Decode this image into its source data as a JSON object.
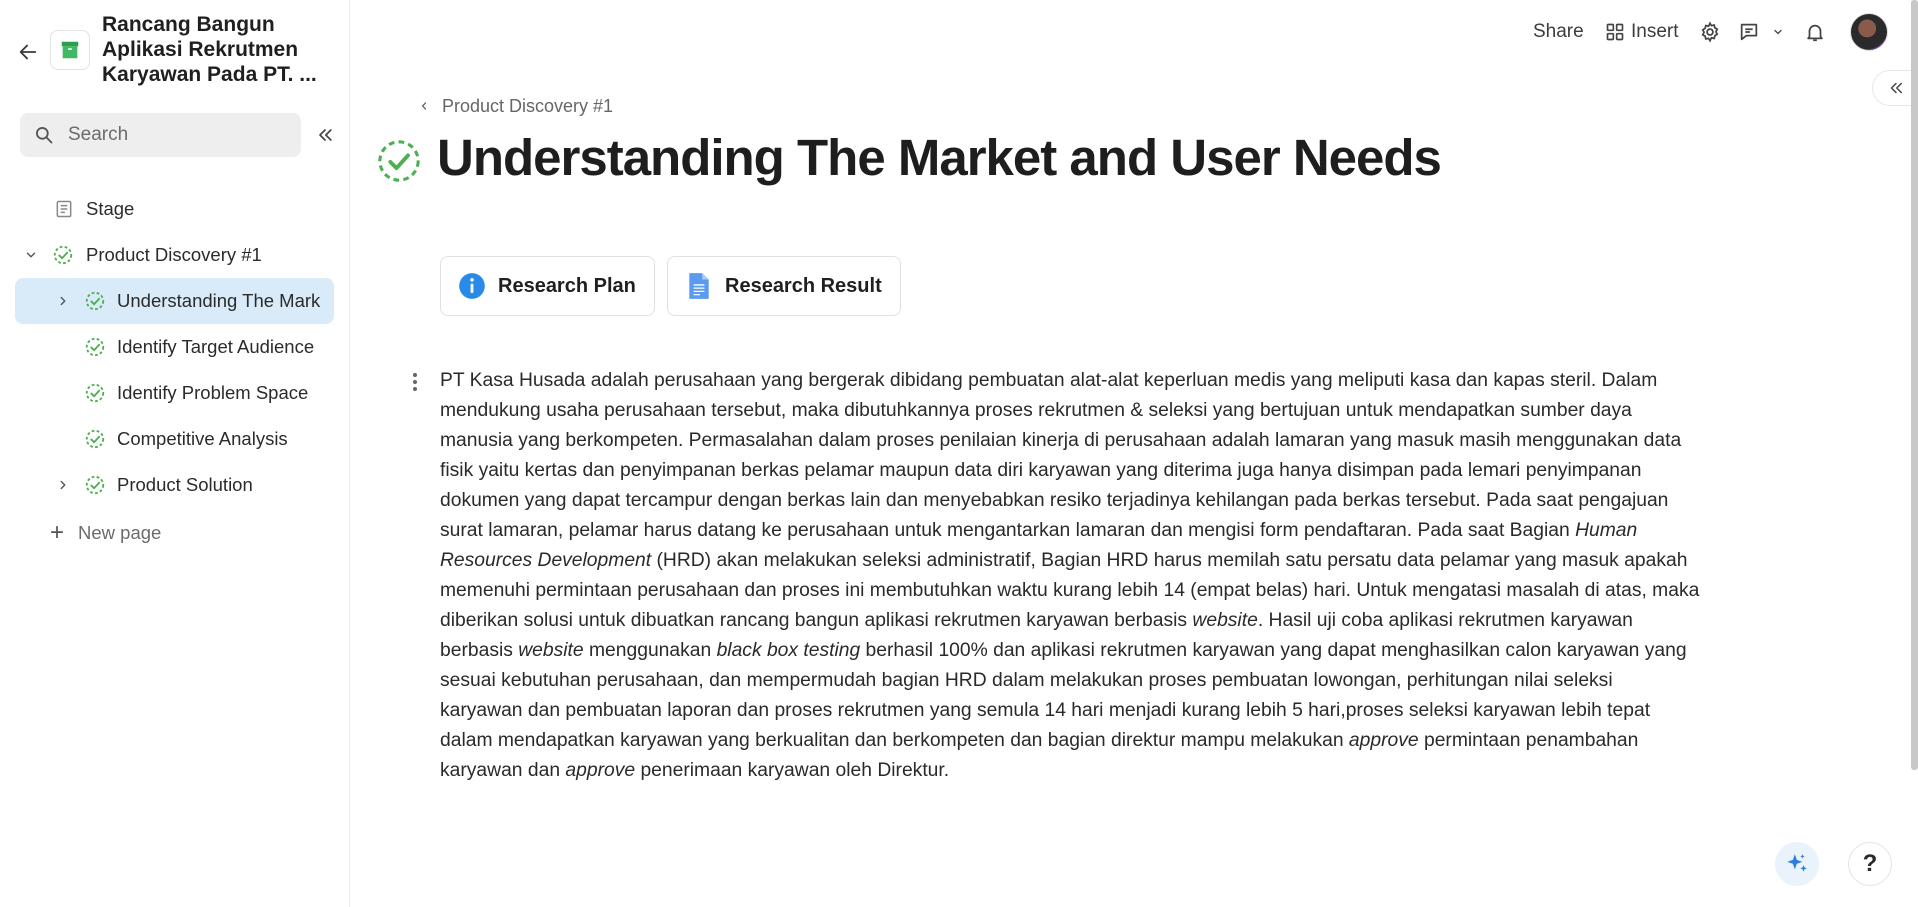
{
  "colors": {
    "accent": "#4caf50",
    "active_bg": "#d9eaf9",
    "info_blue": "#2a8ae8",
    "doc_blue": "#5b9bef"
  },
  "sidebar": {
    "app_title": "Rancang Bangun Aplikasi Rekrutmen Karyawan Pada PT. ...",
    "search_placeholder": "Search",
    "items": [
      {
        "label": "Stage",
        "icon": "document-icon"
      },
      {
        "label": "Product Discovery #1",
        "icon": "progress-check-icon",
        "expanded": true
      },
      {
        "label": "Understanding The Mark",
        "icon": "progress-check-icon",
        "active": true
      },
      {
        "label": "Identify Target Audience",
        "icon": "progress-check-icon"
      },
      {
        "label": "Identify Problem Space",
        "icon": "progress-check-icon"
      },
      {
        "label": "Competitive Analysis",
        "icon": "progress-check-icon"
      },
      {
        "label": "Product Solution",
        "icon": "progress-check-icon"
      }
    ],
    "new_page_label": "New page"
  },
  "topbar": {
    "share_label": "Share",
    "insert_label": "Insert"
  },
  "main": {
    "breadcrumb": "Product Discovery #1",
    "title": "Understanding The Market and User Needs",
    "links": [
      {
        "label": "Research Plan",
        "icon": "info-icon"
      },
      {
        "label": "Research Result",
        "icon": "doc-file-icon"
      }
    ],
    "paragraph": {
      "p1": "PT Kasa Husada adalah perusahaan yang bergerak dibidang pembuatan alat-alat keperluan medis yang meliputi kasa dan kapas steril. Dalam mendukung usaha perusahaan tersebut, maka dibutuhkannya proses rekrutmen & seleksi yang bertujuan untuk mendapatkan sumber daya manusia yang berkompeten. Permasalahan dalam proses penilaian kinerja di perusahaan adalah lamaran yang masuk masih menggunakan data fisik yaitu kertas dan penyimpanan berkas pelamar maupun data diri karyawan yang diterima juga hanya disimpan pada lemari penyimpanan dokumen yang dapat tercampur dengan berkas lain dan menyebabkan resiko terjadinya kehilangan pada berkas tersebut. Pada saat pengajuan surat lamaran, pelamar harus datang ke perusahaan untuk mengantarkan lamaran dan mengisi form pendaftaran. Pada saat Bagian ",
      "i1": "Human Resources Development",
      "p2": " (HRD) akan melakukan seleksi administratif, Bagian HRD harus memilah satu persatu data pelamar yang masuk apakah memenuhi permintaan perusahaan dan proses ini membutuhkan waktu kurang lebih 14 (empat belas) hari. Untuk mengatasi masalah di atas, maka diberikan solusi untuk dibuatkan rancang bangun aplikasi rekrutmen karyawan berbasis ",
      "i2": "website",
      "p3": ". Hasil uji coba aplikasi rekrutmen karyawan berbasis ",
      "i3": "website",
      "p4": " menggunakan ",
      "i4": "black box testing",
      "p5": " berhasil 100% dan aplikasi rekrutmen karyawan yang dapat menghasilkan calon karyawan yang sesuai kebutuhan perusahaan, dan mempermudah bagian HRD dalam melakukan proses pembuatan lowongan, perhitungan nilai seleksi karyawan dan pembuatan laporan dan proses rekrutmen yang semula 14 hari menjadi kurang lebih 5 hari,proses seleksi karyawan lebih tepat dalam mendapatkan karyawan yang berkualitan dan berkompeten dan bagian direktur mampu melakukan ",
      "i5": "approve",
      "p6": " permintaan penambahan karyawan dan ",
      "i6": "approve",
      "p7": " penerimaan karyawan oleh Direktur."
    }
  },
  "help_label": "?"
}
